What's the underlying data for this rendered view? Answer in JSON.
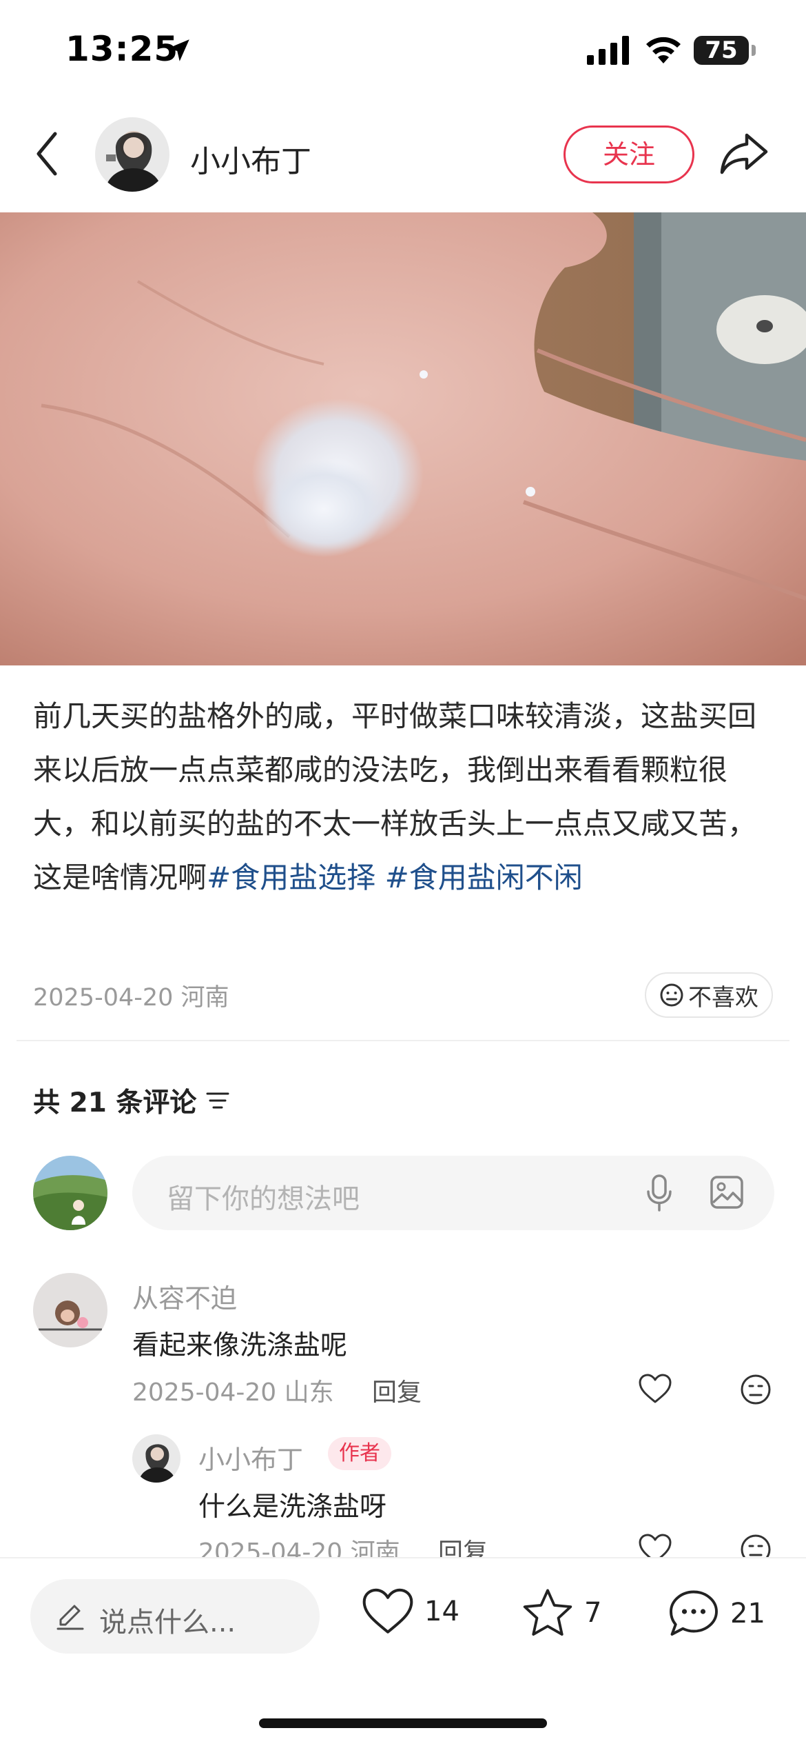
{
  "status_bar": {
    "time": "13:25",
    "battery": "75"
  },
  "header": {
    "author_name": "小小布丁",
    "follow_label": "关注"
  },
  "post": {
    "text_parts": [
      {
        "text": "前几天买的盐格外的咸，平时做菜口味较清淡，这盐买回来以后放一点点菜都咸的没法吃，我倒出来看看颗粒很大，和以前买的盐的不太一样放舌头上一点点又咸又苦，这是啥情况啊",
        "hashtag": false
      },
      {
        "text": "#食用盐选择",
        "hashtag": true
      },
      {
        "text": " ",
        "hashtag": false
      },
      {
        "text": "#食用盐闲不闲",
        "hashtag": true
      }
    ],
    "date_location": "2025-04-20 河南",
    "dislike_label": "不喜欢"
  },
  "comments_section": {
    "count_label": "共 21 条评论",
    "input_placeholder": "留下你的想法吧"
  },
  "comments": [
    {
      "user": "从容不迫",
      "text": "看起来像洗涤盐呢",
      "meta": "2025-04-20 山东",
      "reply_label": "回复"
    },
    {
      "user": "小小布丁",
      "badge": "作者",
      "text": "什么是洗涤盐呀",
      "meta": "2025-04-20 河南",
      "reply_label": "回复"
    }
  ],
  "bottom_bar": {
    "say_placeholder": "说点什么...",
    "likes": "14",
    "stars": "7",
    "comments": "21"
  },
  "colors": {
    "accent": "#e8344e",
    "hashtag": "#1f4f8b",
    "muted": "#9a9a9a"
  }
}
